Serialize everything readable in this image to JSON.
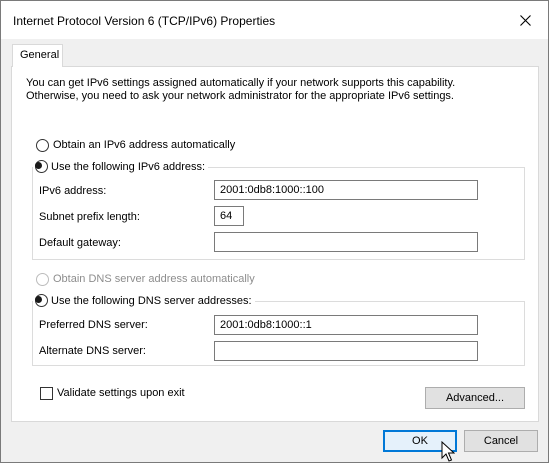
{
  "window": {
    "title": "Internet Protocol Version 6 (TCP/IPv6) Properties"
  },
  "tabs": [
    {
      "label": "General",
      "selected": true
    }
  ],
  "intro": {
    "line1": "You can get IPv6 settings assigned automatically if your network supports this capability.",
    "line2": "Otherwise, you need to ask your network administrator for the appropriate IPv6 settings."
  },
  "ipv6": {
    "auto_label": "Obtain an IPv6 address automatically",
    "auto_selected": false,
    "manual_label": "Use the following IPv6 address:",
    "manual_selected": true,
    "address_label": "IPv6 address:",
    "address_value": "2001:0db8:1000::100",
    "prefix_label": "Subnet prefix length:",
    "prefix_value": "64",
    "gateway_label": "Default gateway:",
    "gateway_value": ""
  },
  "dns": {
    "auto_label": "Obtain DNS server address automatically",
    "auto_enabled": false,
    "manual_label": "Use the following DNS server addresses:",
    "manual_selected": true,
    "preferred_label": "Preferred DNS server:",
    "preferred_value": "2001:0db8:1000::1",
    "alternate_label": "Alternate DNS server:",
    "alternate_value": ""
  },
  "validate": {
    "label": "Validate settings upon exit",
    "checked": false
  },
  "buttons": {
    "advanced": "Advanced...",
    "ok": "OK",
    "cancel": "Cancel"
  },
  "icons": {
    "close": "close-icon",
    "cursor": "mouse-pointer-icon"
  },
  "colors": {
    "default_button_border": "#0078d7",
    "window_bg": "#f0f0f0",
    "panel_bg": "#ffffff"
  }
}
